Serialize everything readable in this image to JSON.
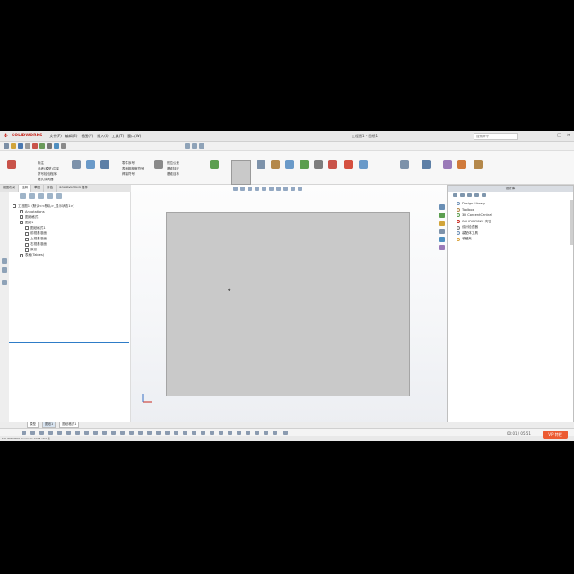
{
  "titlebar": {
    "logo_text": "SOLIDWORKS",
    "menu": [
      "文件(F)",
      "编辑(E)",
      "视图(V)",
      "插入(I)",
      "工具(T)",
      "窗口(W)"
    ],
    "title": "工程图1 - 图纸1",
    "search_placeholder": "搜索命令",
    "window_controls": [
      "–",
      "□",
      "×"
    ]
  },
  "command_manager": {
    "left_labels": [
      "标注",
      "参考(模型)注释",
      "拼写检验程序",
      "格式涂刷器"
    ],
    "mid_labels": [
      "零件序号",
      "表面粗糙度符号",
      "焊接符号"
    ],
    "highlight_label": "表格",
    "ribbon_tabs": [
      "视图布局",
      "注解",
      "草图",
      "评估",
      "SOLIDWORKS 插件"
    ]
  },
  "feature_tree": {
    "toolbar_icons": [
      "feature-manager-icon",
      "property-manager-icon",
      "configuration-manager-icon",
      "dimxpert-icon",
      "display-manager-icon"
    ],
    "items": [
      {
        "level": "root",
        "label": "工程图1（默认<<默认>_显示状态1>）"
      },
      {
        "level": "l1",
        "label": "Annotations"
      },
      {
        "level": "l1",
        "label": "图纸格式"
      },
      {
        "level": "l1",
        "label": "图纸1"
      },
      {
        "level": "l2",
        "label": "图纸格式1"
      },
      {
        "level": "l2",
        "label": "前视基准面"
      },
      {
        "level": "l2",
        "label": "上视基准面"
      },
      {
        "level": "l2",
        "label": "右视基准面"
      },
      {
        "level": "l2",
        "label": "原点"
      },
      {
        "level": "l1",
        "label": "表格(Tables)"
      }
    ]
  },
  "task_pane": {
    "title": "设计库",
    "items": [
      {
        "label": "Design Library",
        "color": "#6c8fb6"
      },
      {
        "label": "Toolbox",
        "color": "#b4884a"
      },
      {
        "label": "3D ContentCentral",
        "color": "#5b9e4f"
      },
      {
        "label": "SOLIDWORKS 内容",
        "color": "#c8281e"
      },
      {
        "label": "设计检查器",
        "color": "#7d7d7d"
      },
      {
        "label": "装配体工具",
        "color": "#6c8fb6"
      },
      {
        "label": "收藏夹",
        "color": "#d9a23a"
      }
    ]
  },
  "sheet_tabs": [
    "模型",
    "图纸1",
    "图纸格式1"
  ],
  "status_text": "SOLIDWORKS Premium 2018 x64 版",
  "video": {
    "timecode": "00:01 / 05:51",
    "button_label": "VIP 特权"
  },
  "colors": {
    "accent_red": "#c8281e",
    "rollback_blue": "#2e7cc7",
    "drawing_gray": "#c9c9c9"
  }
}
